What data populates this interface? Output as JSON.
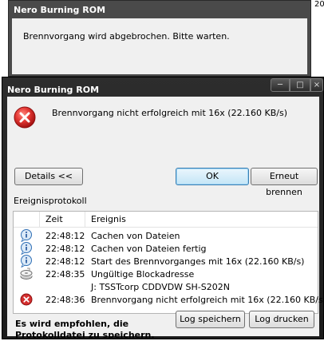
{
  "corner_number": "20",
  "background_dialog": {
    "title": "Nero Burning ROM",
    "message": "Brennvorgang wird abgebrochen. Bitte warten."
  },
  "dialog": {
    "title": "Nero Burning ROM",
    "message": "Brennvorgang nicht erfolgreich mit 16x (22.160 KB/s)",
    "buttons": {
      "details": "Details <<",
      "ok": "OK",
      "reburn": "Erneut brennen",
      "save_log": "Log speichern",
      "print_log": "Log drucken"
    },
    "log_title": "Ereignisprotokoll",
    "columns": {
      "time": "Zeit",
      "event": "Ereignis"
    },
    "log_rows": [
      {
        "icon": "info-icon",
        "time": "22:48:12",
        "event": "Cachen von Dateien"
      },
      {
        "icon": "info-icon",
        "time": "22:48:12",
        "event": "Cachen von Dateien fertig"
      },
      {
        "icon": "info-icon",
        "time": "22:48:12",
        "event": "Start des Brennvorganges mit 16x (22.160 KB/s)"
      },
      {
        "icon": "drive-warning-icon",
        "time": "22:48:35",
        "event": "Ungültige Blockadresse"
      },
      {
        "icon": "",
        "time": "",
        "event": "J: TSSTcorp CDDVDW SH-S202N"
      },
      {
        "icon": "error-icon",
        "time": "22:48:36",
        "event": "Brennvorgang nicht erfolgreich mit 16x (22.160 KB/s)"
      }
    ],
    "hint_line1": "Es wird empfohlen, die",
    "hint_line2": "Protokolldatei zu speichern."
  }
}
